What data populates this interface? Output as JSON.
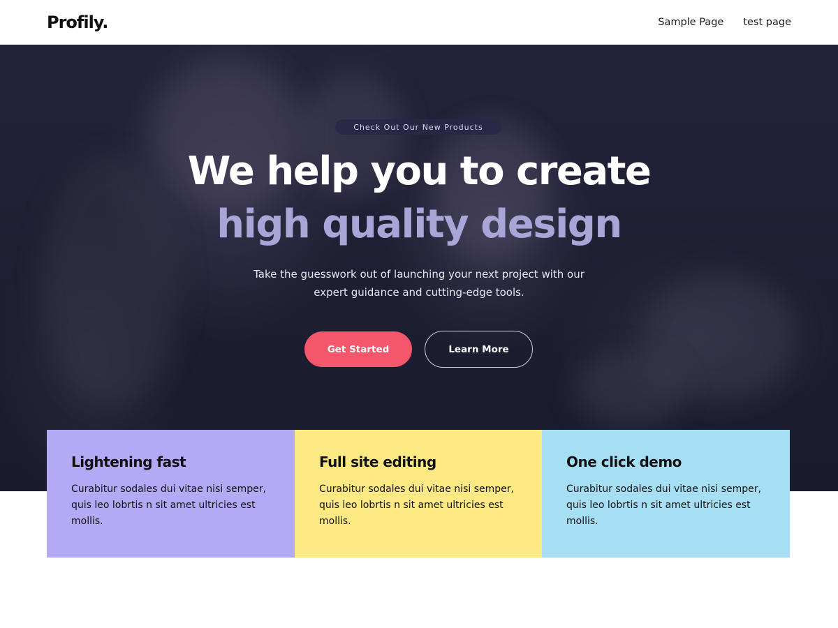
{
  "header": {
    "logo": "Profily.",
    "nav": [
      "Sample Page",
      "test page"
    ]
  },
  "hero": {
    "badge": "Check Out Our New Products",
    "headline_line1": "We help you to create",
    "headline_line2": "high quality design",
    "subtext": "Take the guesswork out of launching your next project with our expert guidance and cutting-edge tools.",
    "primary_button": "Get Started",
    "secondary_button": "Learn More"
  },
  "features": [
    {
      "title": "Lightening fast",
      "text": "Curabitur sodales dui vitae nisi semper, quis leo lobrtis n sit amet ultricies est mollis.",
      "color": "#b3a9f5"
    },
    {
      "title": "Full site editing",
      "text": "Curabitur sodales dui vitae nisi semper, quis leo lobrtis n sit amet ultricies est mollis.",
      "color": "#fce984"
    },
    {
      "title": "One click demo",
      "text": "Curabitur sodales dui vitae nisi semper, quis leo lobrtis n sit amet ultricies est mollis.",
      "color": "#a6dff4"
    }
  ],
  "colors": {
    "accent": "#f4566b",
    "headline_secondary": "#a7a6d6",
    "hero_background": "#1e1e33"
  }
}
